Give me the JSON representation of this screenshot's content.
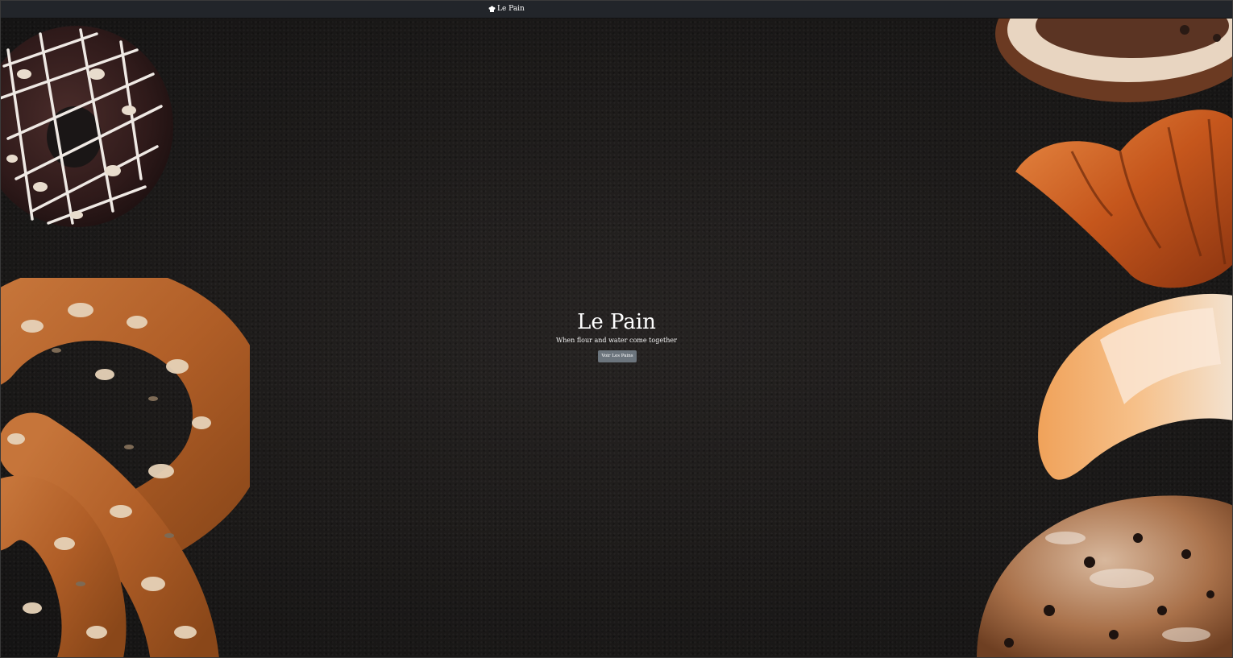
{
  "navbar": {
    "brand_icon": "chef-hat-icon",
    "brand_label": "Le Pain"
  },
  "hero": {
    "title": "Le Pain",
    "subtitle": "When flour and water come together",
    "button_label": "Voir Les Pains"
  },
  "colors": {
    "navbar_bg": "#22252a",
    "page_bg": "#1c1a19",
    "button_bg": "#6c757d",
    "text": "#ffffff"
  }
}
